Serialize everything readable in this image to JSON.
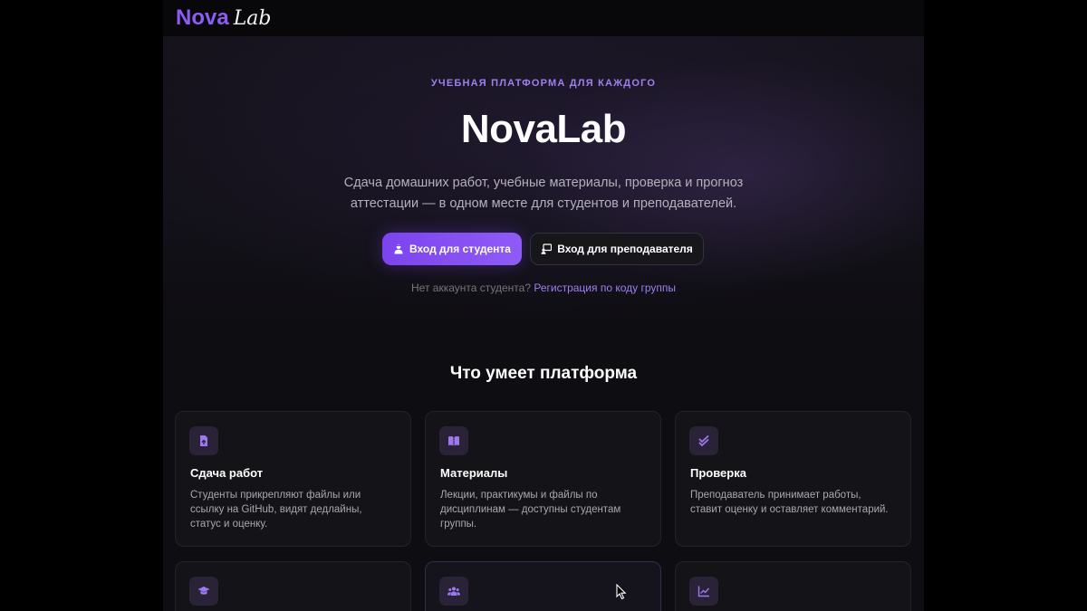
{
  "brand": {
    "logo_primary": "Nova",
    "logo_secondary": "Lab",
    "accent": "#8d5cf3"
  },
  "hero": {
    "eyebrow": "УЧЕБНАЯ ПЛАТФОРМА ДЛЯ КАЖДОГО",
    "title": "NovaLab",
    "subtitle_line1": "Сдача домашних работ, учебные материалы, проверка и прогноз",
    "subtitle_line2": "аттестации — в одном месте для студентов и преподавателей.",
    "student_button": "Вход для студента",
    "teacher_button": "Вход для преподавателя",
    "register_prompt": "Нет аккаунта студента?",
    "register_link": "Регистрация по коду группы"
  },
  "features": {
    "title": "Что умеет платформа",
    "cards": [
      {
        "icon": "file-upload-icon",
        "title": "Сдача работ",
        "text": "Студенты прикрепляют файлы или ссылку на GitHub, видят дедлайны, статус и оценку."
      },
      {
        "icon": "book-icon",
        "title": "Материалы",
        "text": "Лекции, практикумы и файлы по дисциплинам — доступны студентам группы."
      },
      {
        "icon": "check-icon",
        "title": "Проверка",
        "text": "Преподаватель принимает работы, ставит оценку и оставляет комментарий."
      },
      {
        "icon": "graduation-cap-icon",
        "title": "",
        "text": ""
      },
      {
        "icon": "users-icon",
        "title": "",
        "text": ""
      },
      {
        "icon": "chart-line-icon",
        "title": "",
        "text": ""
      }
    ]
  }
}
